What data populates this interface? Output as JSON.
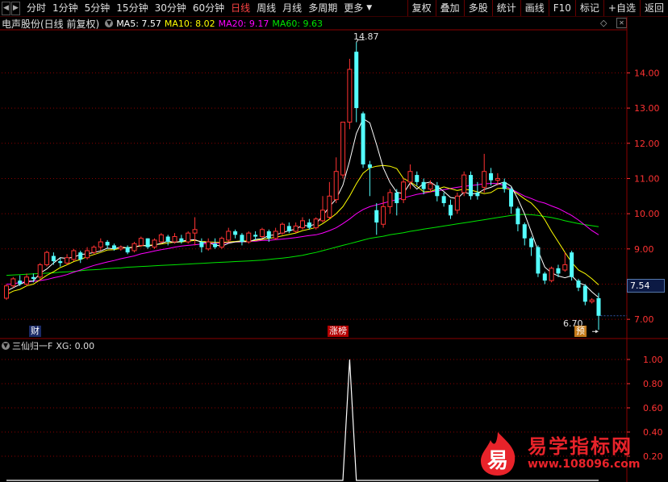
{
  "toolbar": {
    "period_tabs": [
      "分时",
      "1分钟",
      "5分钟",
      "15分钟",
      "30分钟",
      "60分钟",
      "日线",
      "周线",
      "月线",
      "多周期",
      "更多"
    ],
    "active_tab": "日线",
    "right_buttons": [
      "复权",
      "叠加",
      "多股",
      "统计",
      "画线",
      "F10",
      "标记",
      "+自选",
      "返回"
    ]
  },
  "chart_header": {
    "stock_title": "电声股份(日线 前复权)",
    "ma5": "MA5: 7.57",
    "ma10": "MA10: 8.02",
    "ma20": "MA20: 9.17",
    "ma60": "MA60: 9.63"
  },
  "colors": {
    "up": "#ff3232",
    "down": "#54ffff",
    "ma5": "#ffffff",
    "ma10": "#ffff00",
    "ma20": "#ff00ff",
    "ma60": "#00e600",
    "grid": "#8b0000",
    "axis_text": "#ff3232",
    "brand": "#e8232a"
  },
  "annotations": {
    "high_label": "14.87",
    "low_label": "6.70",
    "current_price": "7.54",
    "badge_cai": "财",
    "badge_zhangbang": "涨榜",
    "badge_yu": "预"
  },
  "indicator": {
    "title": "三仙归一F",
    "xg_label": "XG: 0.00"
  },
  "logo": {
    "glyph": "易",
    "title": "易学指标网",
    "url": "www.108096.com"
  },
  "chart_data": [
    {
      "type": "candlestick",
      "y_ticks": [
        "14.00",
        "13.00",
        "12.00",
        "11.00",
        "10.00",
        "9.00",
        "8.00",
        "7.00"
      ],
      "ylim": [
        6.5,
        15.2
      ],
      "candles": [
        [
          7.6,
          7.95,
          7.55,
          7.99
        ],
        [
          7.95,
          8.15,
          7.9,
          8.2
        ],
        [
          8.1,
          8.0,
          7.95,
          8.25
        ],
        [
          8.0,
          8.2,
          7.95,
          8.3
        ],
        [
          8.2,
          8.15,
          8.05,
          8.3
        ],
        [
          8.2,
          8.55,
          8.1,
          8.6
        ],
        [
          8.55,
          8.9,
          8.5,
          8.95
        ],
        [
          8.8,
          8.65,
          8.55,
          8.9
        ],
        [
          8.65,
          8.6,
          8.5,
          8.75
        ],
        [
          8.6,
          8.75,
          8.55,
          8.85
        ],
        [
          8.7,
          8.95,
          8.65,
          9.0
        ],
        [
          8.9,
          8.7,
          8.6,
          8.95
        ],
        [
          8.75,
          8.95,
          8.7,
          9.05
        ],
        [
          8.9,
          9.05,
          8.85,
          9.1
        ],
        [
          9.05,
          9.2,
          8.95,
          9.3
        ],
        [
          9.2,
          9.1,
          9.0,
          9.25
        ],
        [
          9.1,
          9.0,
          8.95,
          9.15
        ],
        [
          9.0,
          9.05,
          8.95,
          9.1
        ],
        [
          9.05,
          8.9,
          8.85,
          9.1
        ],
        [
          8.95,
          9.15,
          8.9,
          9.2
        ],
        [
          9.1,
          9.3,
          9.05,
          9.35
        ],
        [
          9.3,
          9.05,
          9.0,
          9.3
        ],
        [
          9.05,
          9.25,
          9.0,
          9.3
        ],
        [
          9.2,
          9.4,
          9.15,
          9.45
        ],
        [
          9.35,
          9.2,
          9.1,
          9.4
        ],
        [
          9.2,
          9.35,
          9.15,
          9.45
        ],
        [
          9.3,
          9.2,
          9.15,
          9.4
        ],
        [
          9.2,
          9.45,
          9.15,
          9.5
        ],
        [
          9.45,
          9.55,
          9.1,
          9.9
        ],
        [
          9.2,
          9.05,
          8.9,
          9.3
        ],
        [
          9.0,
          9.2,
          8.95,
          9.3
        ],
        [
          9.15,
          9.05,
          9.0,
          9.3
        ],
        [
          9.05,
          9.3,
          9.0,
          9.35
        ],
        [
          9.25,
          9.5,
          9.2,
          9.6
        ],
        [
          9.5,
          9.4,
          9.3,
          9.55
        ],
        [
          9.4,
          9.2,
          9.1,
          9.45
        ],
        [
          9.2,
          9.45,
          9.15,
          9.5
        ],
        [
          9.4,
          9.35,
          9.25,
          9.5
        ],
        [
          9.35,
          9.55,
          9.3,
          9.6
        ],
        [
          9.5,
          9.3,
          9.2,
          9.55
        ],
        [
          9.3,
          9.5,
          9.25,
          9.6
        ],
        [
          9.45,
          9.7,
          9.4,
          9.75
        ],
        [
          9.65,
          9.5,
          9.45,
          9.75
        ],
        [
          9.5,
          9.65,
          9.45,
          9.75
        ],
        [
          9.6,
          9.8,
          9.55,
          9.9
        ],
        [
          9.75,
          9.6,
          9.55,
          9.85
        ],
        [
          9.6,
          9.85,
          9.55,
          9.9
        ],
        [
          9.8,
          10.1,
          9.75,
          10.5
        ],
        [
          9.9,
          10.5,
          9.85,
          10.9
        ],
        [
          10.4,
          11.2,
          10.3,
          11.6
        ],
        [
          11.1,
          12.6,
          11.0,
          12.6
        ],
        [
          12.6,
          14.1,
          12.4,
          14.4
        ],
        [
          14.6,
          13.0,
          12.6,
          14.87
        ],
        [
          12.85,
          11.4,
          11.3,
          12.9
        ],
        [
          11.4,
          11.3,
          10.5,
          11.5
        ],
        [
          10.1,
          9.75,
          9.4,
          10.3
        ],
        [
          9.7,
          10.2,
          9.6,
          10.5
        ],
        [
          10.2,
          10.6,
          10.0,
          10.7
        ],
        [
          10.6,
          10.3,
          9.95,
          10.7
        ],
        [
          10.4,
          10.9,
          10.3,
          11.0
        ],
        [
          10.9,
          11.2,
          10.7,
          11.4
        ],
        [
          11.1,
          10.9,
          10.8,
          11.2
        ],
        [
          10.9,
          10.7,
          10.55,
          11.0
        ],
        [
          10.7,
          10.85,
          10.6,
          10.95
        ],
        [
          10.8,
          10.5,
          10.35,
          10.9
        ],
        [
          10.5,
          10.3,
          10.2,
          10.6
        ],
        [
          10.25,
          9.95,
          9.85,
          10.4
        ],
        [
          10.1,
          10.5,
          10.0,
          10.6
        ],
        [
          10.6,
          11.1,
          10.5,
          11.2
        ],
        [
          11.1,
          10.5,
          10.4,
          11.2
        ],
        [
          10.6,
          10.5,
          10.4,
          10.9
        ],
        [
          10.75,
          11.2,
          10.6,
          11.7
        ],
        [
          11.15,
          10.95,
          10.8,
          11.3
        ],
        [
          10.95,
          11.0,
          10.8,
          11.15
        ],
        [
          10.9,
          10.7,
          10.6,
          11.0
        ],
        [
          10.7,
          10.2,
          10.0,
          10.75
        ],
        [
          10.15,
          9.7,
          9.5,
          10.2
        ],
        [
          9.7,
          9.3,
          9.1,
          9.75
        ],
        [
          9.3,
          9.05,
          8.8,
          9.35
        ],
        [
          9.05,
          8.3,
          8.2,
          9.1
        ],
        [
          8.3,
          8.1,
          8.0,
          8.35
        ],
        [
          8.1,
          8.45,
          8.05,
          8.5
        ],
        [
          8.45,
          8.3,
          8.2,
          8.55
        ],
        [
          8.4,
          8.55,
          8.35,
          8.9
        ],
        [
          8.9,
          8.2,
          8.1,
          8.95
        ],
        [
          8.1,
          7.9,
          7.8,
          8.15
        ],
        [
          7.95,
          7.5,
          7.4,
          8.0
        ],
        [
          7.5,
          7.55,
          7.45,
          7.6
        ],
        [
          7.6,
          7.1,
          6.7,
          7.75
        ]
      ],
      "ma5": [
        7.8,
        7.9,
        7.99,
        8.08,
        8.09,
        8.31,
        8.43,
        8.6,
        8.75,
        8.73,
        8.77,
        8.84,
        8.86,
        8.9,
        8.94,
        9.02,
        9.0,
        9.06,
        9.02,
        9.05,
        9.1,
        9.08,
        9.11,
        9.16,
        9.22,
        9.18,
        9.22,
        9.25,
        9.26,
        9.19,
        9.18,
        9.11,
        9.08,
        9.16,
        9.2,
        9.21,
        9.2,
        9.27,
        9.29,
        9.38,
        9.4,
        9.46,
        9.52,
        9.56,
        9.67,
        9.65,
        9.71,
        9.94,
        10.2,
        10.42,
        10.81,
        11.5,
        12.28,
        12.7,
        12.58,
        11.96,
        11.3,
        10.89,
        10.61,
        10.57,
        10.88,
        10.7,
        10.86,
        10.9,
        10.77,
        10.63,
        10.46,
        10.43,
        10.61,
        10.56,
        10.58,
        10.69,
        10.75,
        10.84,
        10.9,
        10.78,
        10.42,
        9.99,
        9.48,
        8.95,
        8.48,
        8.32,
        8.23,
        8.18,
        8.24,
        8.04,
        7.97,
        7.78,
        7.62
      ],
      "ma10": [
        7.7,
        7.8,
        7.85,
        7.95,
        8.0,
        8.12,
        8.25,
        8.35,
        8.47,
        8.55,
        8.64,
        8.7,
        8.78,
        8.84,
        8.9,
        8.97,
        8.98,
        9.02,
        9.04,
        9.05,
        9.09,
        9.1,
        9.12,
        9.14,
        9.17,
        9.19,
        9.2,
        9.22,
        9.24,
        9.21,
        9.2,
        9.19,
        9.18,
        9.2,
        9.21,
        9.23,
        9.22,
        9.24,
        9.27,
        9.3,
        9.33,
        9.37,
        9.41,
        9.45,
        9.52,
        9.56,
        9.61,
        9.72,
        9.85,
        10.0,
        10.2,
        10.5,
        10.85,
        11.15,
        11.3,
        11.35,
        11.37,
        11.35,
        11.28,
        11.0,
        10.9,
        10.78,
        10.62,
        10.63,
        10.7,
        10.76,
        10.71,
        10.66,
        10.7,
        10.67,
        10.62,
        10.57,
        10.6,
        10.72,
        10.73,
        10.68,
        10.56,
        10.42,
        10.3,
        10.1,
        9.83,
        9.5,
        9.2,
        8.9,
        8.62,
        8.4,
        8.3,
        8.15,
        7.98
      ],
      "ma20": [
        8.0,
        8.0,
        8.05,
        8.06,
        8.08,
        8.1,
        8.13,
        8.18,
        8.22,
        8.27,
        8.34,
        8.4,
        8.47,
        8.53,
        8.58,
        8.63,
        8.67,
        8.72,
        8.76,
        8.8,
        8.86,
        8.9,
        8.94,
        8.98,
        9.01,
        9.05,
        9.08,
        9.1,
        9.12,
        9.14,
        9.16,
        9.16,
        9.16,
        9.18,
        9.2,
        9.2,
        9.22,
        9.22,
        9.24,
        9.24,
        9.26,
        9.28,
        9.3,
        9.32,
        9.35,
        9.38,
        9.4,
        9.45,
        9.52,
        9.6,
        9.72,
        9.85,
        10.0,
        10.12,
        10.2,
        10.25,
        10.3,
        10.35,
        10.4,
        10.45,
        10.5,
        10.55,
        10.58,
        10.62,
        10.65,
        10.68,
        10.72,
        10.75,
        10.78,
        10.8,
        10.82,
        10.85,
        10.86,
        10.86,
        10.8,
        10.7,
        10.6,
        10.5,
        10.43,
        10.35,
        10.3,
        10.22,
        10.15,
        10.05,
        9.95,
        9.82,
        9.67,
        9.52,
        9.4
      ],
      "ma60": [
        8.25,
        8.26,
        8.27,
        8.28,
        8.29,
        8.3,
        8.31,
        8.32,
        8.34,
        8.35,
        8.36,
        8.38,
        8.4,
        8.41,
        8.42,
        8.44,
        8.45,
        8.46,
        8.48,
        8.49,
        8.5,
        8.51,
        8.52,
        8.53,
        8.54,
        8.55,
        8.56,
        8.57,
        8.58,
        8.59,
        8.6,
        8.61,
        8.62,
        8.63,
        8.64,
        8.65,
        8.66,
        8.67,
        8.68,
        8.7,
        8.72,
        8.74,
        8.76,
        8.79,
        8.82,
        8.86,
        8.9,
        8.95,
        9.0,
        9.05,
        9.1,
        9.15,
        9.2,
        9.25,
        9.3,
        9.33,
        9.36,
        9.4,
        9.43,
        9.46,
        9.5,
        9.53,
        9.56,
        9.59,
        9.62,
        9.65,
        9.68,
        9.71,
        9.74,
        9.77,
        9.8,
        9.83,
        9.86,
        9.89,
        9.92,
        9.95,
        9.97,
        9.98,
        9.97,
        9.95,
        9.92,
        9.89,
        9.85,
        9.8,
        9.76,
        9.72,
        9.69,
        9.66,
        9.63
      ]
    },
    {
      "type": "line",
      "y_ticks": [
        "1.00",
        "0.80",
        "0.60",
        "0.40",
        "0.20"
      ],
      "ylim": [
        0,
        1.06
      ],
      "values": [
        0,
        0,
        0,
        0,
        0,
        0,
        0,
        0,
        0,
        0,
        0,
        0,
        0,
        0,
        0,
        0,
        0,
        0,
        0,
        0,
        0,
        0,
        0,
        0,
        0,
        0,
        0,
        0,
        0,
        0,
        0,
        0,
        0,
        0,
        0,
        0,
        0,
        0,
        0,
        0,
        0,
        0,
        0,
        0,
        0,
        0,
        0,
        0,
        0,
        0,
        0,
        1,
        0,
        0,
        0,
        0,
        0,
        0,
        0,
        0,
        0,
        0,
        0,
        0,
        0,
        0,
        0,
        0,
        0,
        0,
        0,
        0,
        0,
        0,
        0,
        0,
        0,
        0,
        0,
        0,
        0,
        0,
        0,
        0,
        0,
        0,
        0,
        0,
        0
      ]
    }
  ]
}
